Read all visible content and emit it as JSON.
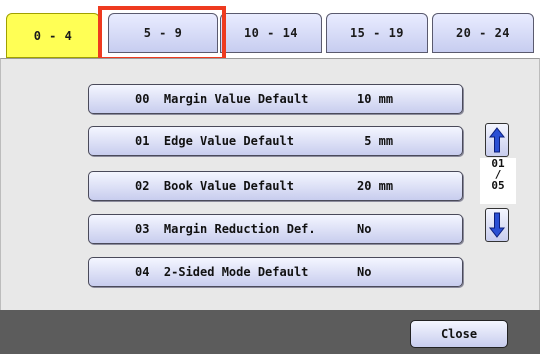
{
  "tabs": [
    {
      "label": "0 - 4"
    },
    {
      "label": "5 - 9"
    },
    {
      "label": "10 - 14"
    },
    {
      "label": "15 - 19"
    },
    {
      "label": "20 - 24"
    }
  ],
  "settings": [
    {
      "label": "00  Margin Value Default",
      "value": "10 mm"
    },
    {
      "label": "01  Edge Value Default",
      "value": " 5 mm"
    },
    {
      "label": "02  Book Value Default",
      "value": "20 mm"
    },
    {
      "label": "03  Margin Reduction Def.",
      "value": "No"
    },
    {
      "label": "04  2-Sided Mode Default",
      "value": "No"
    }
  ],
  "pager": {
    "current": "01",
    "separator": "/",
    "total": "05"
  },
  "footer": {
    "close_label": "Close"
  },
  "colors": {
    "active_tab": "#ffff55",
    "highlight": "#ee3a1f",
    "arrow": "#2a4fd4"
  }
}
